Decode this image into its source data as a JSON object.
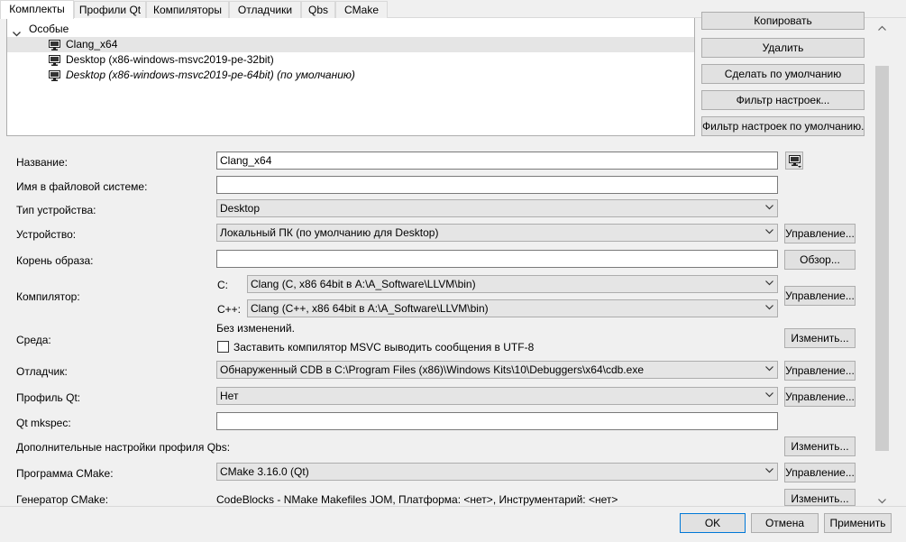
{
  "tabs": [
    "Комплекты",
    "Профили Qt",
    "Компиляторы",
    "Отладчики",
    "Qbs",
    "CMake"
  ],
  "tree": {
    "group_label": "Особые",
    "items": [
      {
        "label": "Clang_x64",
        "selected": true,
        "italic": false
      },
      {
        "label": "Desktop (x86-windows-msvc2019-pe-32bit)",
        "selected": false,
        "italic": false
      },
      {
        "label": "Desktop (x86-windows-msvc2019-pe-64bit) (по умолчанию)",
        "selected": false,
        "italic": true
      }
    ]
  },
  "kit_buttons": {
    "copy": "Копировать",
    "remove": "Удалить",
    "make_default": "Сделать по умолчанию",
    "settings_filter": "Фильтр настроек...",
    "default_settings_filter": "Фильтр настроек по умолчанию..."
  },
  "form": {
    "name": {
      "label": "Название:",
      "value": "Clang_x64"
    },
    "fs_name": {
      "label": "Имя в файловой системе:",
      "value": ""
    },
    "device_type": {
      "label": "Тип устройства:",
      "value": "Desktop"
    },
    "device": {
      "label": "Устройство:",
      "value": "Локальный ПК (по умолчанию для Desktop)",
      "button": "Управление..."
    },
    "sysroot": {
      "label": "Корень образа:",
      "value": "",
      "button": "Обзор..."
    },
    "compiler": {
      "label": "Компилятор:",
      "c_label": "C:",
      "c_value": "Clang (C, x86 64bit в A:\\A_Software\\LLVM\\bin)",
      "cpp_label": "C++:",
      "cpp_value": "Clang (C++, x86 64bit в A:\\A_Software\\LLVM\\bin)",
      "button": "Управление..."
    },
    "environment": {
      "label": "Среда:",
      "status": "Без изменений.",
      "checkbox_label": "Заставить компилятор MSVC выводить сообщения в UTF-8",
      "checked": false,
      "button": "Изменить..."
    },
    "debugger": {
      "label": "Отладчик:",
      "value": "Обнаруженный CDB в C:\\Program Files (x86)\\Windows Kits\\10\\Debuggers\\x64\\cdb.exe",
      "button": "Управление..."
    },
    "qt_profile": {
      "label": "Профиль Qt:",
      "value": "Нет",
      "button": "Управление..."
    },
    "qt_mkspec": {
      "label": "Qt mkspec:",
      "value": ""
    },
    "qbs_settings": {
      "label": "Дополнительные настройки профиля Qbs:",
      "button": "Изменить..."
    },
    "cmake_tool": {
      "label": "Программа CMake:",
      "value": "CMake 3.16.0 (Qt)",
      "button": "Управление..."
    },
    "cmake_generator": {
      "label": "Генератор CMake:",
      "value": "CodeBlocks - NMake Makefiles JOM, Платформа: <нет>, Инструментарий: <нет>",
      "button": "Изменить..."
    }
  },
  "dialog_buttons": {
    "ok": "OK",
    "cancel": "Отмена",
    "apply": "Применить"
  },
  "colors": {
    "selection": "#e5e5e5",
    "button_face": "#e1e1e1",
    "accent": "#0078d7"
  }
}
